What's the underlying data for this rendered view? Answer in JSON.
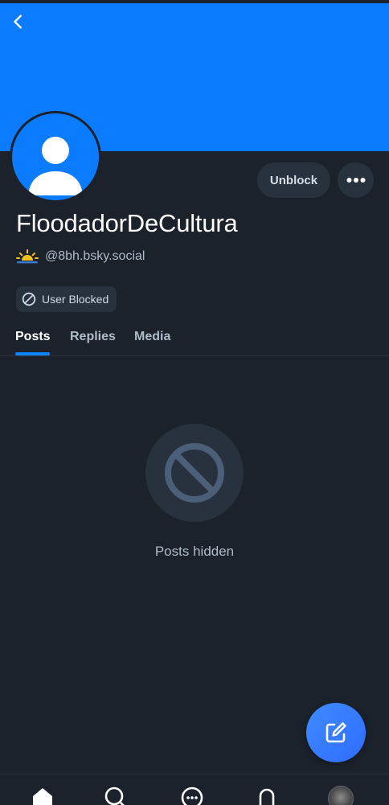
{
  "colors": {
    "background": "#1b222b",
    "banner": "#0b7bff",
    "accent": "#1083fe",
    "surface": "#28323e",
    "muted_text": "#aebbc9"
  },
  "header": {
    "back_icon": "chevron-left-icon"
  },
  "profile": {
    "display_name": "FloodadorDeCultura",
    "handle": "@8bh.bsky.social",
    "handle_emoji": "sunrise-icon",
    "unblock_label": "Unblock",
    "more_icon": "ellipsis-icon",
    "blocked_badge": "User Blocked",
    "avatar_icon": "default-user-avatar"
  },
  "tabs": [
    {
      "label": "Posts",
      "active": true
    },
    {
      "label": "Replies",
      "active": false
    },
    {
      "label": "Media",
      "active": false
    }
  ],
  "feed": {
    "empty_icon": "block-icon",
    "empty_text": "Posts hidden"
  },
  "fab": {
    "icon": "compose-icon"
  },
  "bottom_nav": [
    {
      "name": "home",
      "icon": "home-icon"
    },
    {
      "name": "search",
      "icon": "search-icon"
    },
    {
      "name": "chat",
      "icon": "chat-icon"
    },
    {
      "name": "notifications",
      "icon": "bell-icon"
    },
    {
      "name": "profile",
      "icon": "avatar"
    }
  ]
}
